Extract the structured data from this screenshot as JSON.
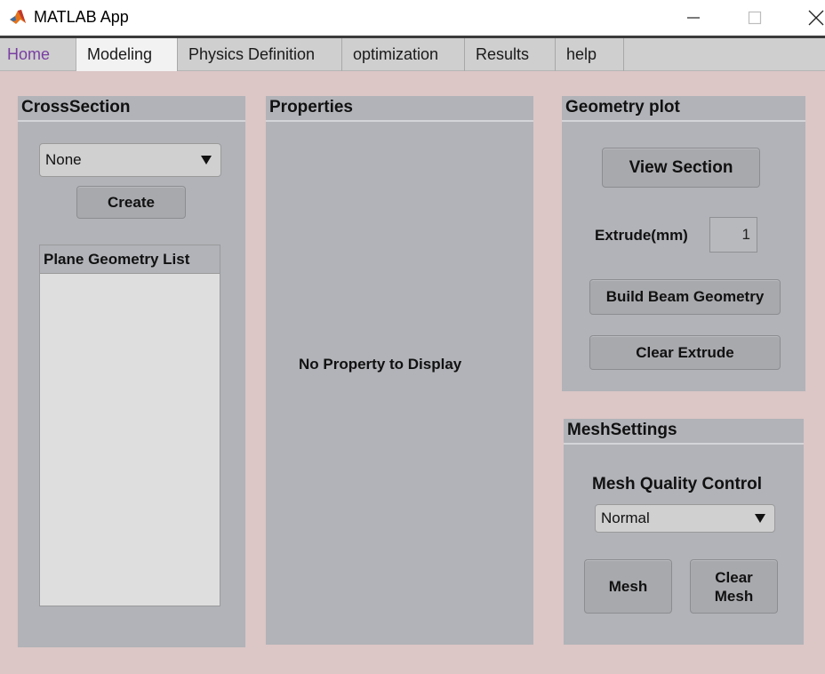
{
  "window": {
    "title": "MATLAB App"
  },
  "tabs": [
    {
      "label": "Home"
    },
    {
      "label": "Modeling"
    },
    {
      "label": "Physics Definition"
    },
    {
      "label": "optimization"
    },
    {
      "label": "Results"
    },
    {
      "label": "help"
    }
  ],
  "cross_section": {
    "title": "CrossSection",
    "dropdown_value": "None",
    "create_label": "Create",
    "list_title": "Plane Geometry List",
    "list_items": []
  },
  "properties": {
    "title": "Properties",
    "empty_message": "No Property to Display"
  },
  "geometry_plot": {
    "title": "Geometry plot",
    "view_section_label": "View Section",
    "extrude_label": "Extrude(mm)",
    "extrude_value": "1",
    "build_beam_label": "Build Beam Geometry",
    "clear_extrude_label": "Clear Extrude"
  },
  "mesh_settings": {
    "title": "MeshSettings",
    "quality_label": "Mesh Quality Control",
    "quality_value": "Normal",
    "mesh_label": "Mesh",
    "clear_mesh_label": "Clear\nMesh"
  },
  "colors": {
    "background": "#dcc6c6",
    "panel": "#b1b3b8",
    "home_tab": "#7a3ea3"
  }
}
